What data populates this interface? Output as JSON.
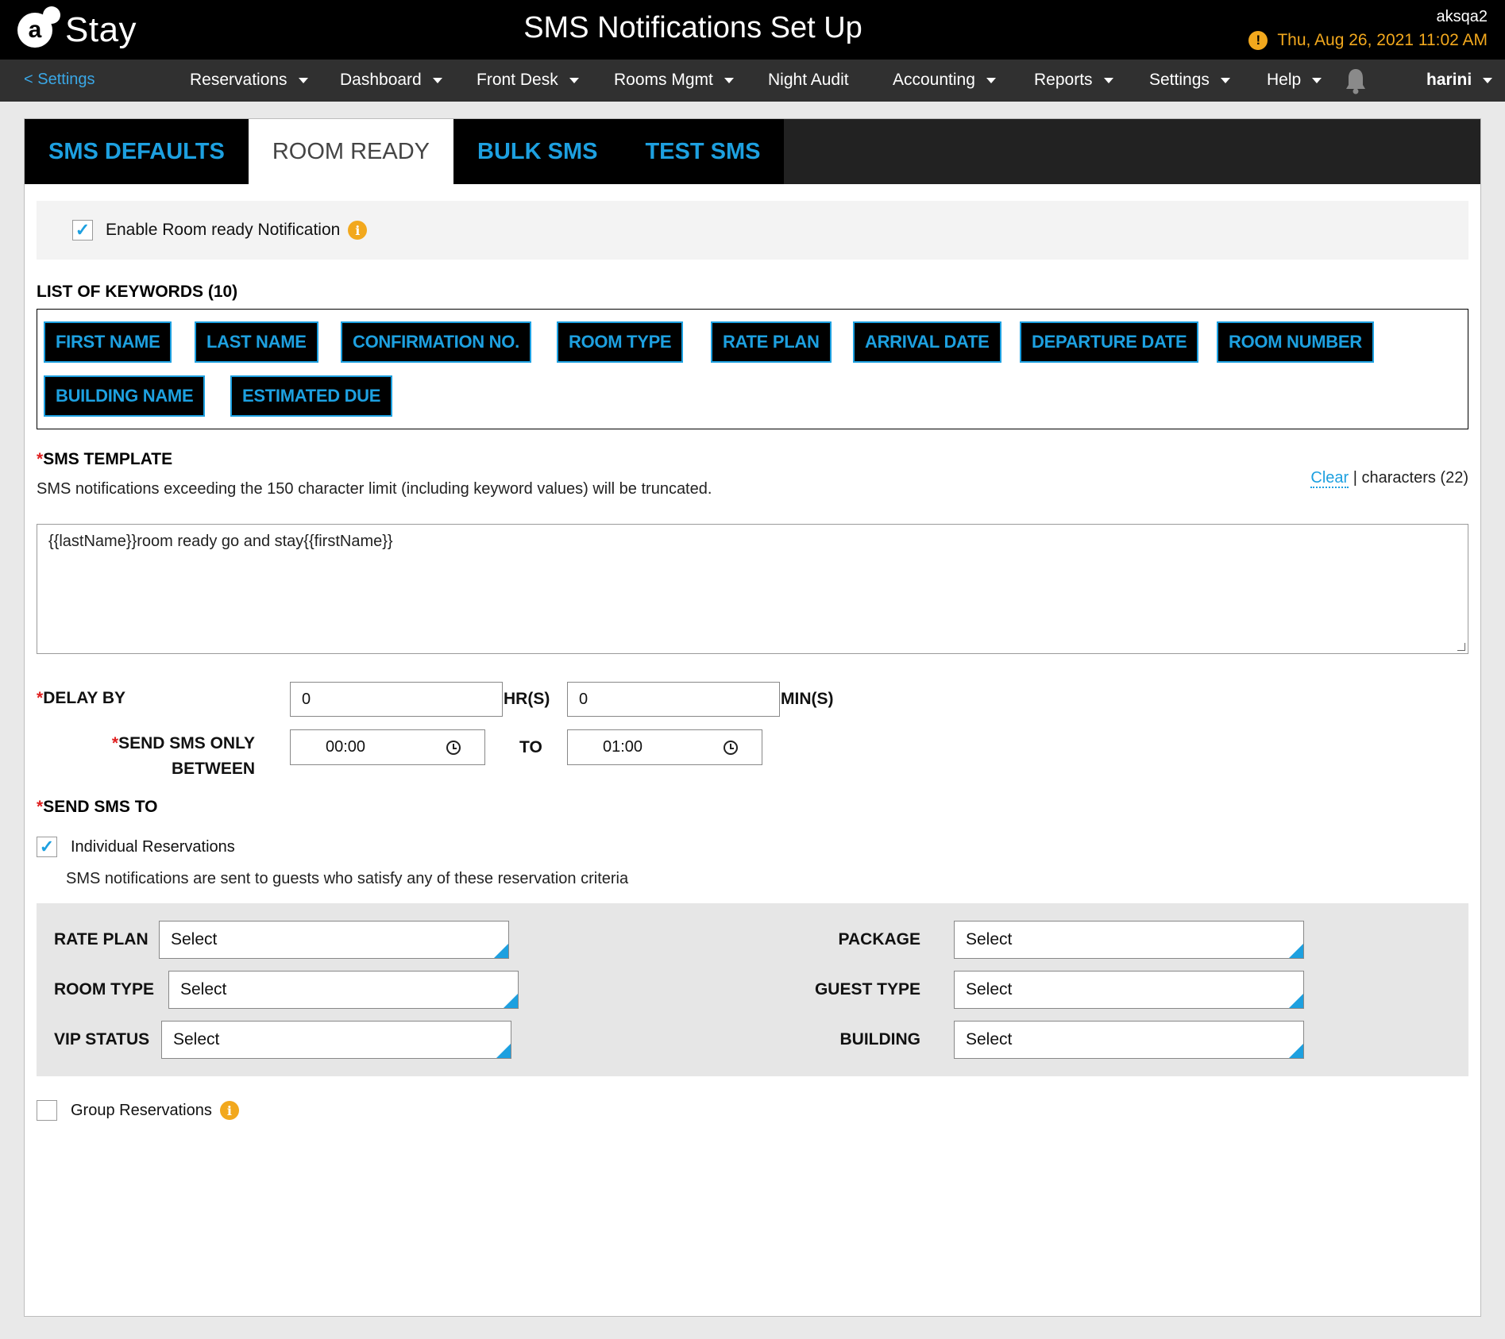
{
  "header": {
    "logo_text": "Stay",
    "logo_mark": "a",
    "title": "SMS Notifications Set Up",
    "property": "aksqa2",
    "datetime": "Thu, Aug 26, 2021 11:02 AM",
    "warning_icon": "exclamation-icon",
    "accent_color": "#f2a81d"
  },
  "nav": {
    "back": "< Settings",
    "items": [
      "Reservations",
      "Dashboard",
      "Front Desk",
      "Rooms Mgmt",
      "Night Audit",
      "Accounting",
      "Reports",
      "Settings",
      "Help"
    ],
    "user": "harini",
    "bell_icon": "bell-icon"
  },
  "tabs": [
    "SMS DEFAULTS",
    "ROOM READY",
    "BULK SMS",
    "TEST SMS"
  ],
  "active_tab": "ROOM READY",
  "enable": {
    "label": "Enable Room ready Notification",
    "checked": true
  },
  "keywords": {
    "title": "LIST OF KEYWORDS (10)",
    "items": [
      "FIRST NAME",
      "LAST NAME",
      "CONFIRMATION NO.",
      "ROOM TYPE",
      "RATE PLAN",
      "ARRIVAL DATE",
      "DEPARTURE DATE",
      "ROOM NUMBER",
      "BUILDING NAME",
      "ESTIMATED DUE"
    ]
  },
  "template": {
    "title": "SMS TEMPLATE",
    "required_mark": "*",
    "note": "SMS notifications exceeding the 150 character limit (including keyword values) will be truncated.",
    "clear": "Clear",
    "separator": "|",
    "chars": "characters (22)",
    "value": "{{lastName}}room ready go and stay{{firstName}}"
  },
  "delay": {
    "label": "DELAY BY",
    "hours": "0",
    "hours_unit": "HR(S)",
    "mins": "0",
    "mins_unit": "MIN(S)"
  },
  "between": {
    "label_line1": "SEND SMS ONLY",
    "label_line2": "BETWEEN",
    "from": "00:00",
    "to_label": "TO",
    "to": "01:00"
  },
  "send_to": {
    "label": "SEND SMS TO",
    "individual_label": "Individual Reservations",
    "individual_checked": true,
    "individual_note": "SMS notifications are sent to guests who satisfy any of these reservation criteria",
    "group_label": "Group Reservations",
    "group_checked": false
  },
  "criteria": {
    "rate_plan": "RATE PLAN",
    "room_type": "ROOM TYPE",
    "vip_status": "VIP STATUS",
    "package": "PACKAGE",
    "guest_type": "GUEST TYPE",
    "building": "BUILDING",
    "select_placeholder": "Select"
  }
}
